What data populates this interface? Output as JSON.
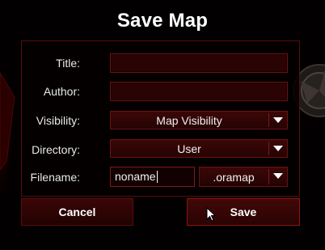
{
  "dialog": {
    "title": "Save Map"
  },
  "form": {
    "title_label": "Title:",
    "title_value": "",
    "author_label": "Author:",
    "author_value": "",
    "visibility_label": "Visibility:",
    "visibility_value": "Map Visibility",
    "directory_label": "Directory:",
    "directory_value": "User",
    "filename_label": "Filename:",
    "filename_value": "noname",
    "extension_value": ".oramap"
  },
  "buttons": {
    "cancel_label": "Cancel",
    "save_label": "Save"
  },
  "colors": {
    "accent": "#6a1212",
    "panel_bg": "#050000",
    "text": "#ffffff"
  },
  "icons": {
    "dropdown_arrow": "triangle-down",
    "cursor": "mouse-pointer"
  }
}
